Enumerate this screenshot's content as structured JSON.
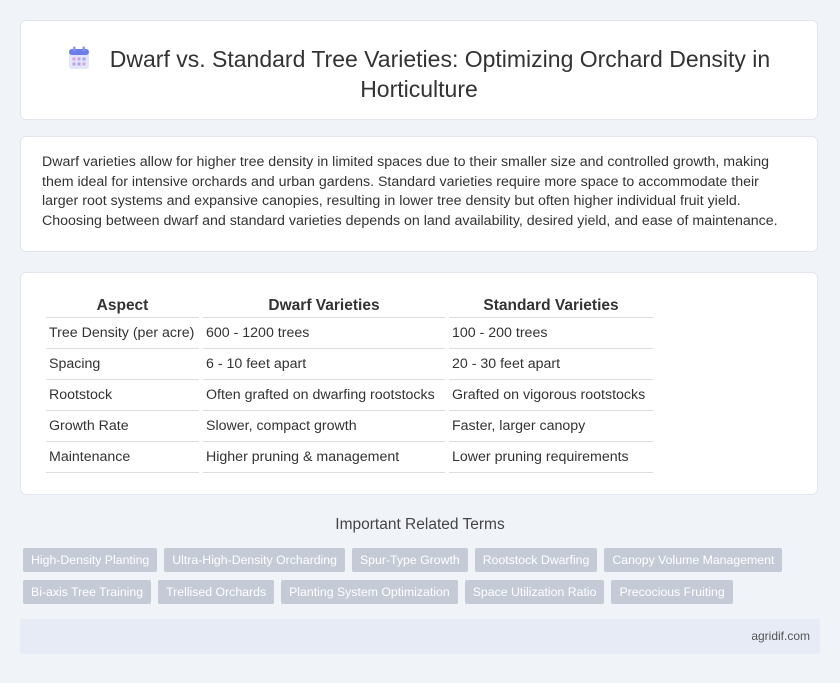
{
  "header": {
    "title": "Dwarf vs. Standard Tree Varieties: Optimizing Orchard Density in Horticulture",
    "icon": "calendar-icon"
  },
  "intro": {
    "text": "Dwarf varieties allow for higher tree density in limited spaces due to their smaller size and controlled growth, making them ideal for intensive orchards and urban gardens. Standard varieties require more space to accommodate their larger root systems and expansive canopies, resulting in lower tree density but often higher individual fruit yield. Choosing between dwarf and standard varieties depends on land availability, desired yield, and ease of maintenance."
  },
  "table": {
    "headers": [
      "Aspect",
      "Dwarf Varieties",
      "Standard Varieties"
    ],
    "rows": [
      [
        "Tree Density (per acre)",
        "600 - 1200 trees",
        "100 - 200 trees"
      ],
      [
        "Spacing",
        "6 - 10 feet apart",
        "20 - 30 feet apart"
      ],
      [
        "Rootstock",
        "Often grafted on dwarfing rootstocks",
        "Grafted on vigorous rootstocks"
      ],
      [
        "Growth Rate",
        "Slower, compact growth",
        "Faster, larger canopy"
      ],
      [
        "Maintenance",
        "Higher pruning & management",
        "Lower pruning requirements"
      ]
    ]
  },
  "related": {
    "title": "Important Related Terms",
    "rows": [
      [
        "High-Density Planting",
        "Ultra-High-Density Orcharding",
        "Spur-Type Growth",
        "Rootstock Dwarfing",
        "Canopy Volume Management"
      ],
      [
        "Bi-axis Tree Training",
        "Trellised Orchards",
        "Planting System Optimization",
        "Space Utilization Ratio",
        "Precocious Fruiting"
      ]
    ]
  },
  "footer": {
    "text": "agridif.com"
  }
}
